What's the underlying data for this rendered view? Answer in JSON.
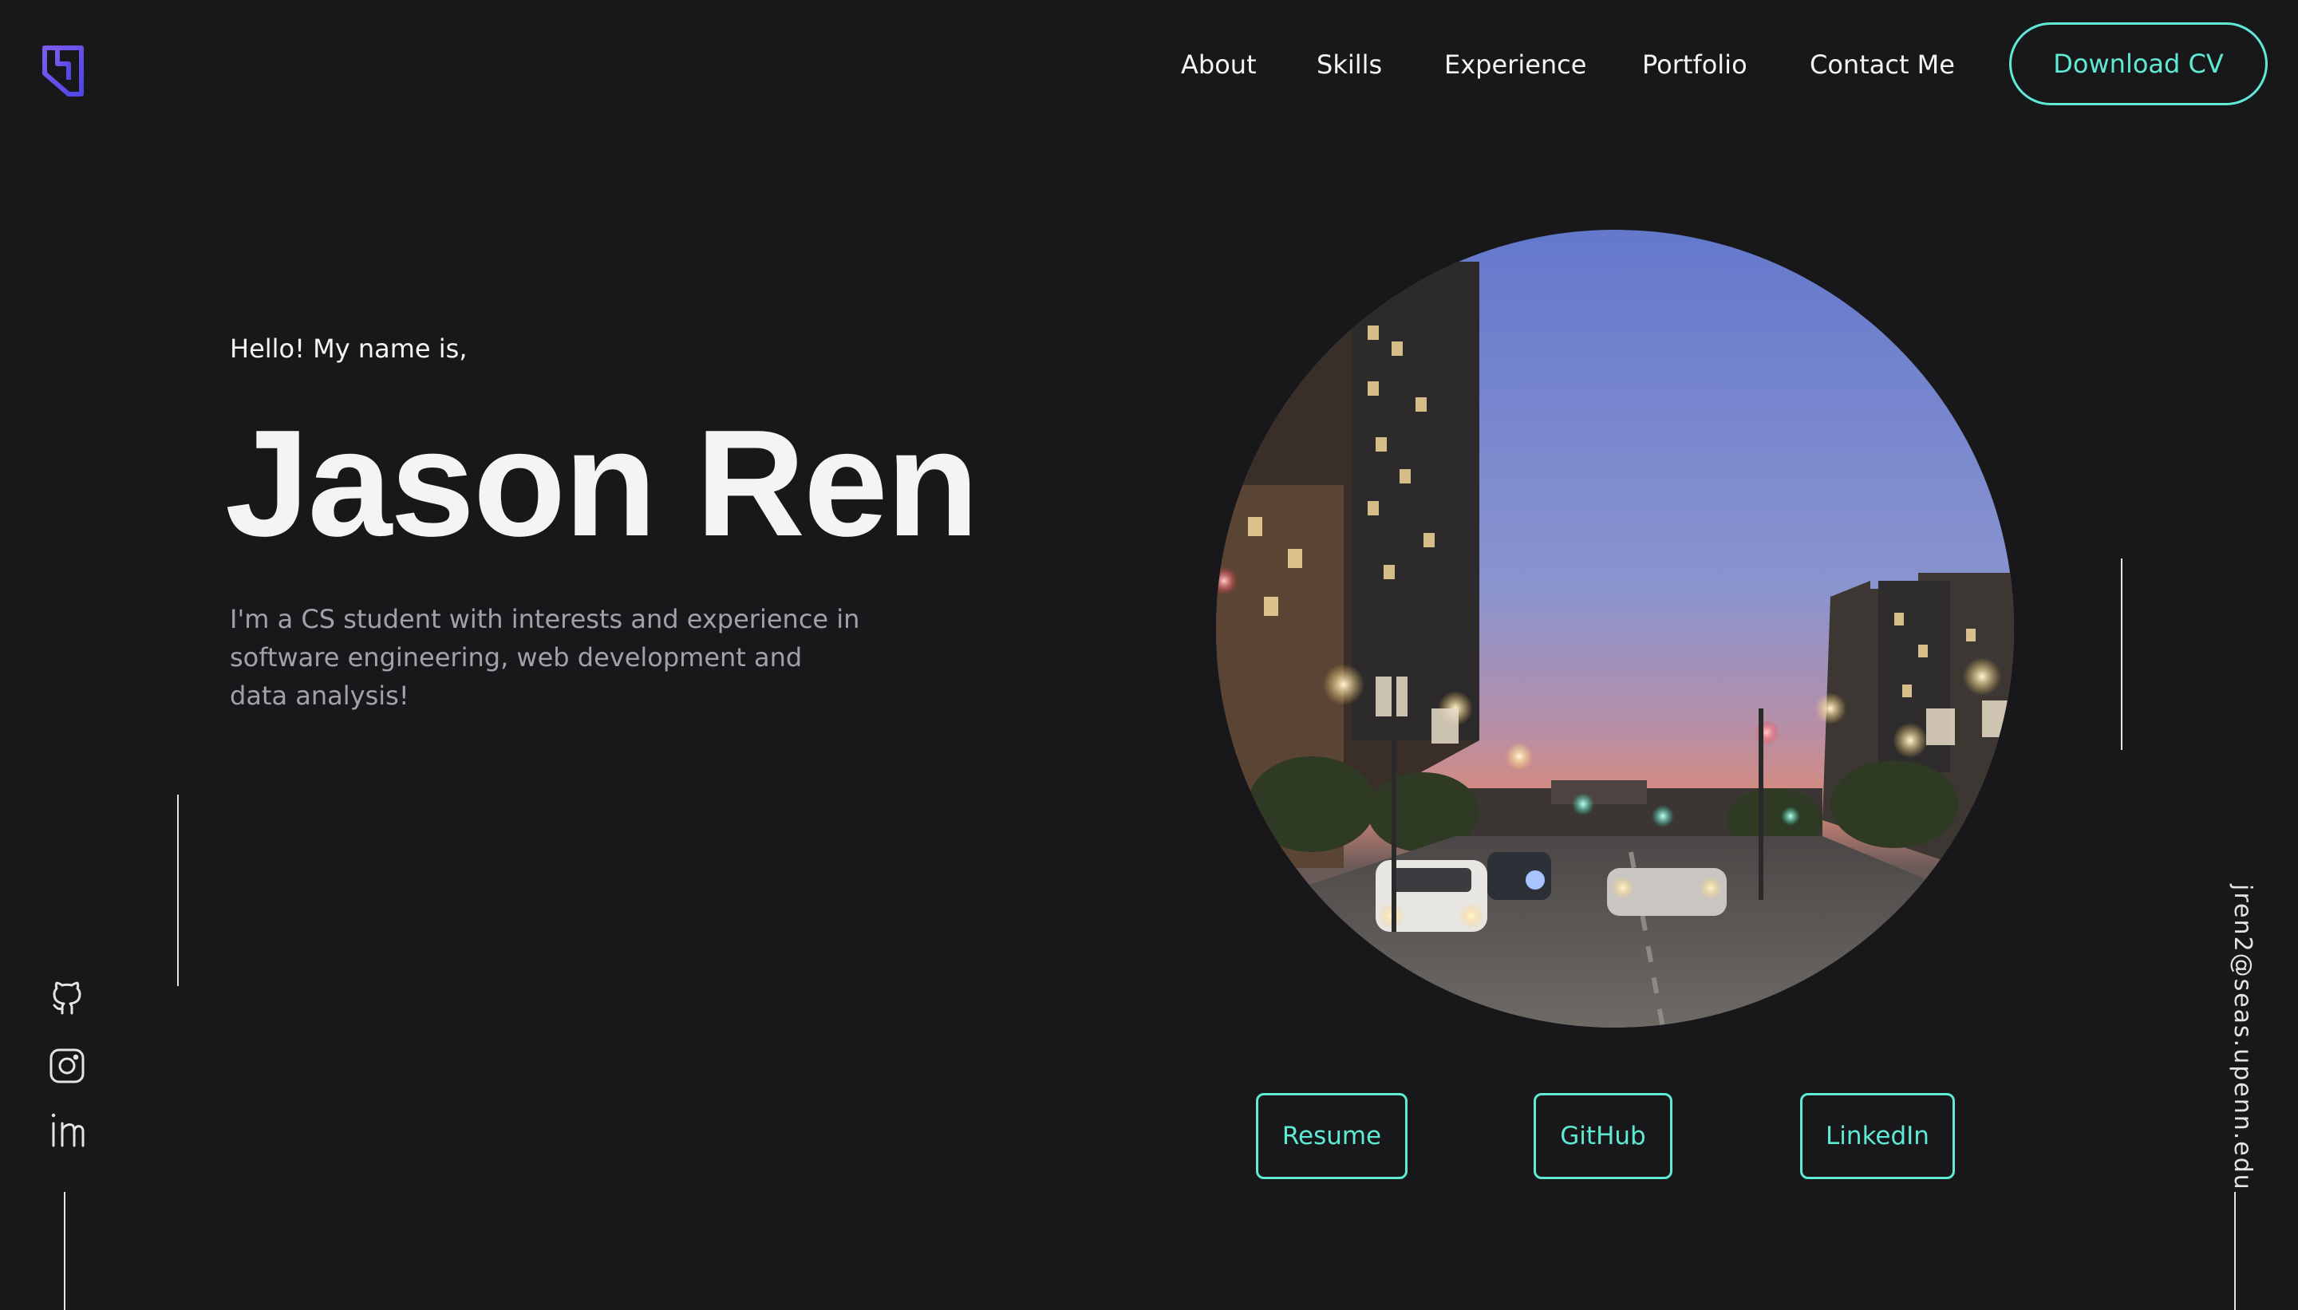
{
  "nav": {
    "items": [
      "About",
      "Skills",
      "Experience",
      "Portfolio",
      "Contact Me"
    ],
    "cta_label": "Download CV"
  },
  "hero": {
    "greeting": "Hello! My name is,",
    "name": "Jason Ren",
    "bio_lines": [
      "I'm a CS student with interests and experience in",
      "software engineering, web development and",
      "data analysis!"
    ]
  },
  "links": {
    "resume": "Resume",
    "github": "GitHub",
    "linkedin": "LinkedIn"
  },
  "social_icons": [
    "github-icon",
    "instagram-icon",
    "linkedin-icon"
  ],
  "email": "jren2@seas.upenn.edu",
  "colors": {
    "background": "#18181b",
    "accent": "#5eead4",
    "logo": "#6d4ee6",
    "text": "#f4f4f5",
    "muted_text": "#a1a1aa"
  }
}
